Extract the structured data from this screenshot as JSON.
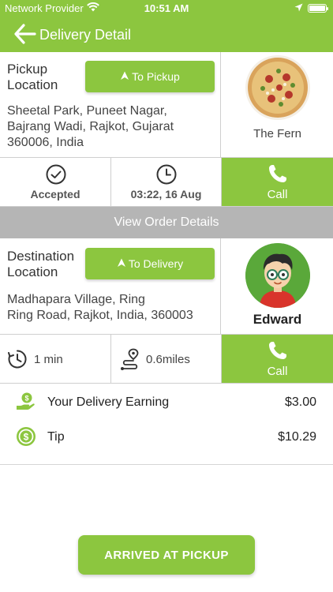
{
  "status_bar": {
    "carrier": "Network Provider",
    "time": "10:51 AM"
  },
  "header": {
    "title": "Delivery Detail"
  },
  "pickup": {
    "heading": "Pickup\nLocation",
    "heading_line1": "Pickup",
    "heading_line2": "Location",
    "button_label": "To Pickup",
    "address_line1": "Sheetal Park, Puneet Nagar,",
    "address_line2": "Bajrang Wadi, Rajkot, Gujarat",
    "address_line3": "360006, India",
    "restaurant_name": "The Fern"
  },
  "order_status": {
    "status_label": "Accepted",
    "datetime": "03:22, 16 Aug",
    "call_label": "Call"
  },
  "view_order": {
    "label": "View Order Details"
  },
  "destination": {
    "heading_line1": "Destination",
    "heading_line2": "Location",
    "button_label": "To Delivery",
    "address_line1": "Madhapara Village, Ring",
    "address_line2": "Ring Road, Rajkot, India, 360003",
    "customer_name": "Edward"
  },
  "trip": {
    "duration": "1 min",
    "distance": "0.6miles",
    "call_label": "Call"
  },
  "earnings": {
    "delivery_label": "Your Delivery Earning",
    "delivery_amount": "$3.00",
    "tip_label": "Tip",
    "tip_amount": "$10.29"
  },
  "footer": {
    "arrived_label": "ARRIVED AT PICKUP"
  },
  "colors": {
    "accent": "#8cc63f",
    "gray_bar": "#b5b5b5",
    "border": "#cfcfcf"
  }
}
